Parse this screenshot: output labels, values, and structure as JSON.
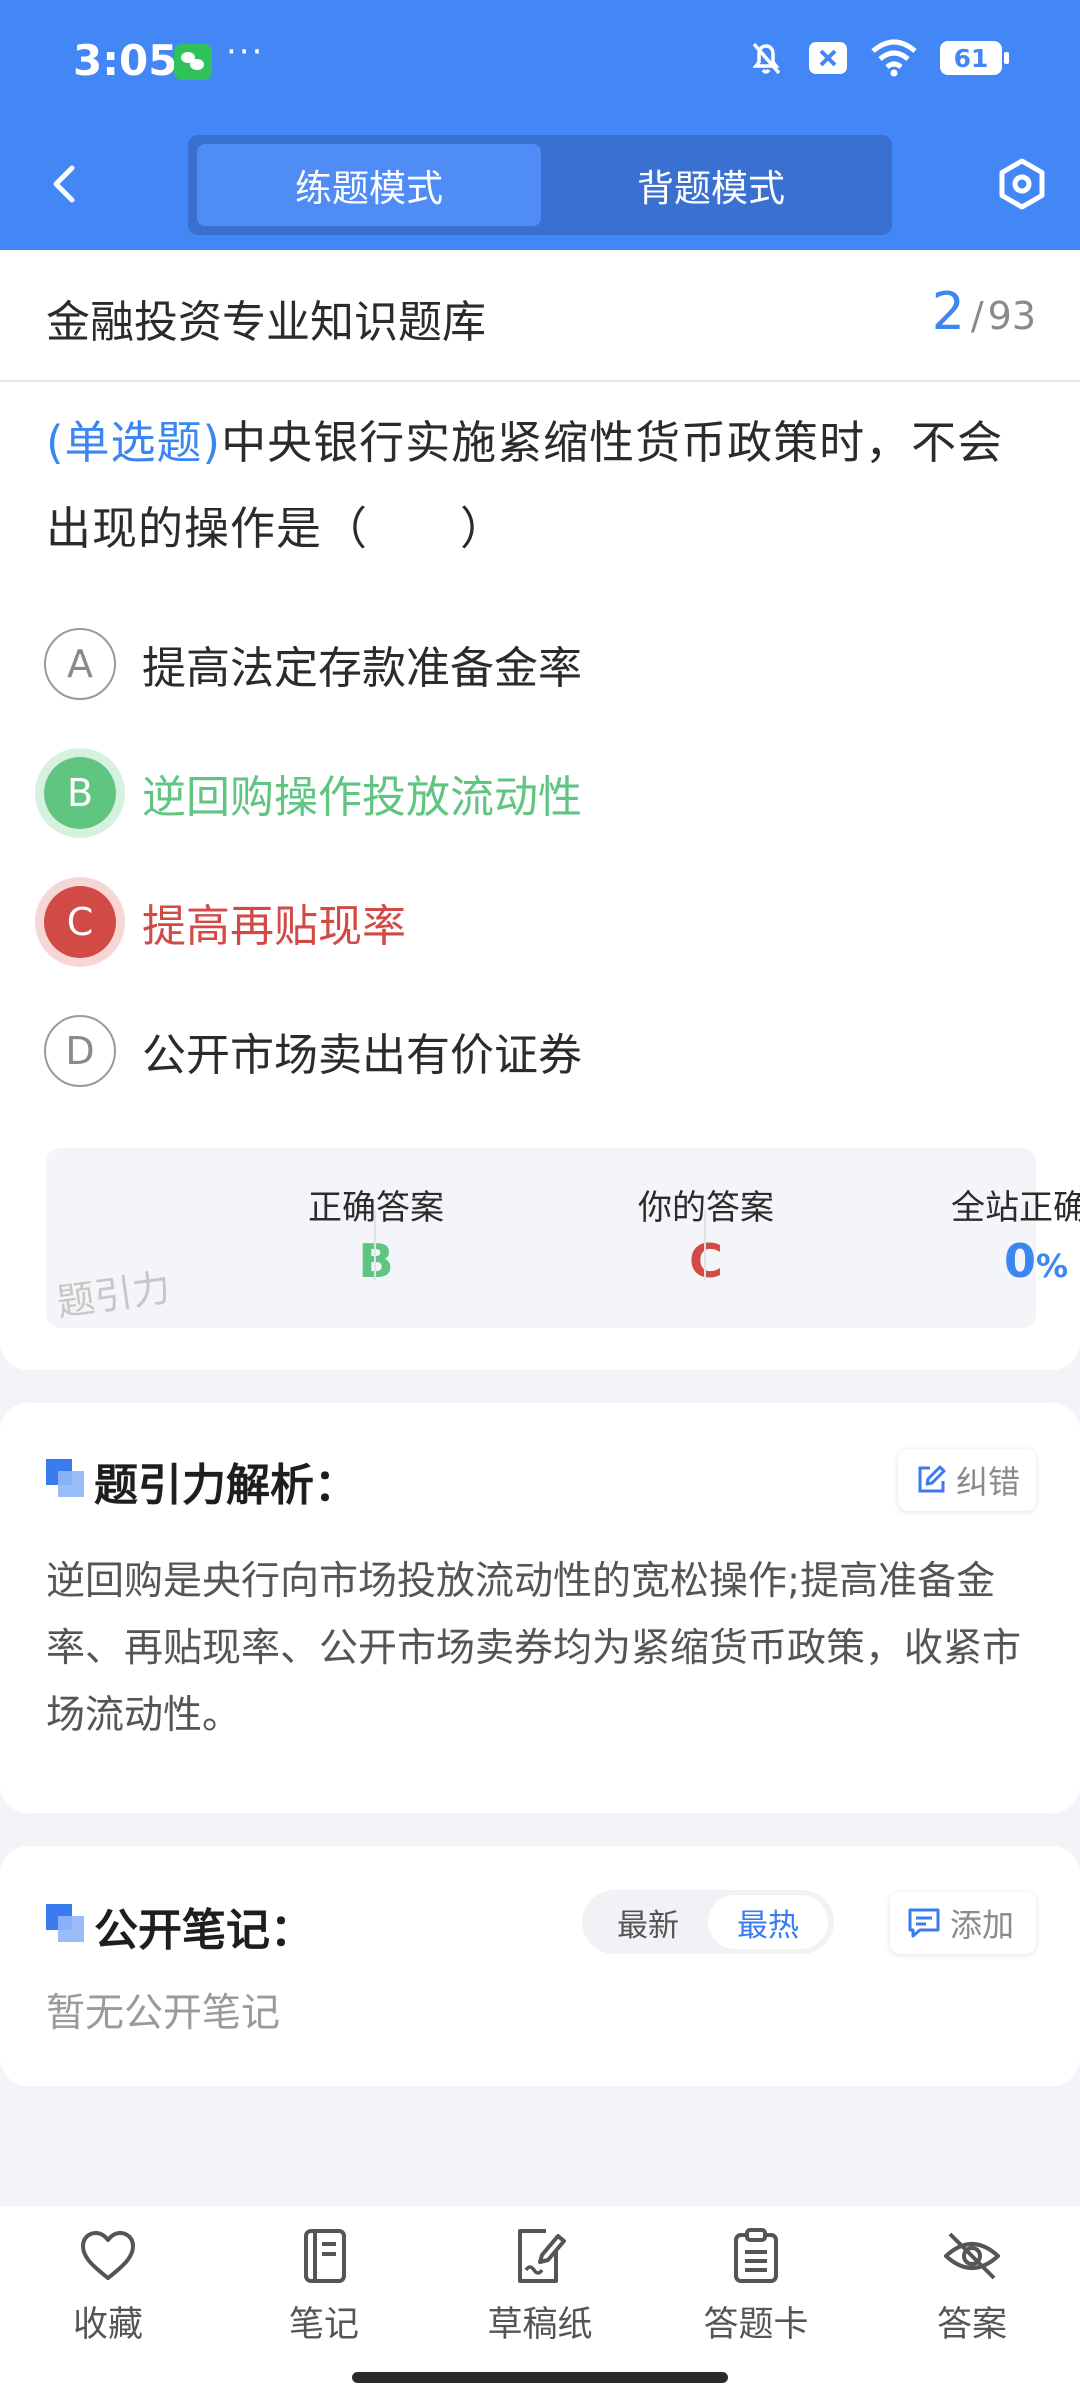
{
  "status_bar": {
    "time": "3:05",
    "more": "···",
    "battery": "61"
  },
  "header": {
    "tabs": [
      {
        "label": "练题模式",
        "active": true
      },
      {
        "label": "背题模式",
        "active": false
      }
    ]
  },
  "bank": {
    "title": "金融投资专业知识题库",
    "current": "2",
    "sep": "/",
    "total": "93"
  },
  "question": {
    "type_label": "(单选题)",
    "text": "中央银行实施紧缩性货币政策时，不会出现的操作是（　　）",
    "options": [
      {
        "letter": "A",
        "text": "提高法定存款准备金率",
        "state": "normal"
      },
      {
        "letter": "B",
        "text": "逆回购操作投放流动性",
        "state": "correct"
      },
      {
        "letter": "C",
        "text": "提高再贴现率",
        "state": "wrong"
      },
      {
        "letter": "D",
        "text": "公开市场卖出有价证券",
        "state": "normal"
      }
    ]
  },
  "answer_summary": {
    "correct_label": "正确答案",
    "correct_value": "B",
    "yours_label": "你的答案",
    "yours_value": "C",
    "rate_label": "全站正确率",
    "rate_value": "0",
    "rate_unit": "%",
    "watermark": "题引力"
  },
  "analysis": {
    "title": "题引力解析：",
    "report_button": "纠错",
    "text": "逆回购是央行向市场投放流动性的宽松操作;提高准备金率、再贴现率、公开市场卖券均为紧缩货币政策，收紧市场流动性。"
  },
  "notes": {
    "title": "公开笔记：",
    "sort_latest": "最新",
    "sort_hot": "最热",
    "add_button": "添加",
    "empty": "暂无公开笔记"
  },
  "bottom_nav": [
    {
      "label": "收藏",
      "icon": "heart-icon"
    },
    {
      "label": "笔记",
      "icon": "notebook-icon"
    },
    {
      "label": "草稿纸",
      "icon": "draft-icon"
    },
    {
      "label": "答题卡",
      "icon": "answer-card-icon"
    },
    {
      "label": "答案",
      "icon": "eye-off-icon"
    }
  ],
  "colors": {
    "primary": "#4386f5",
    "correct": "#5fc581",
    "wrong": "#d24a45",
    "accent_text": "#3b86f0"
  }
}
